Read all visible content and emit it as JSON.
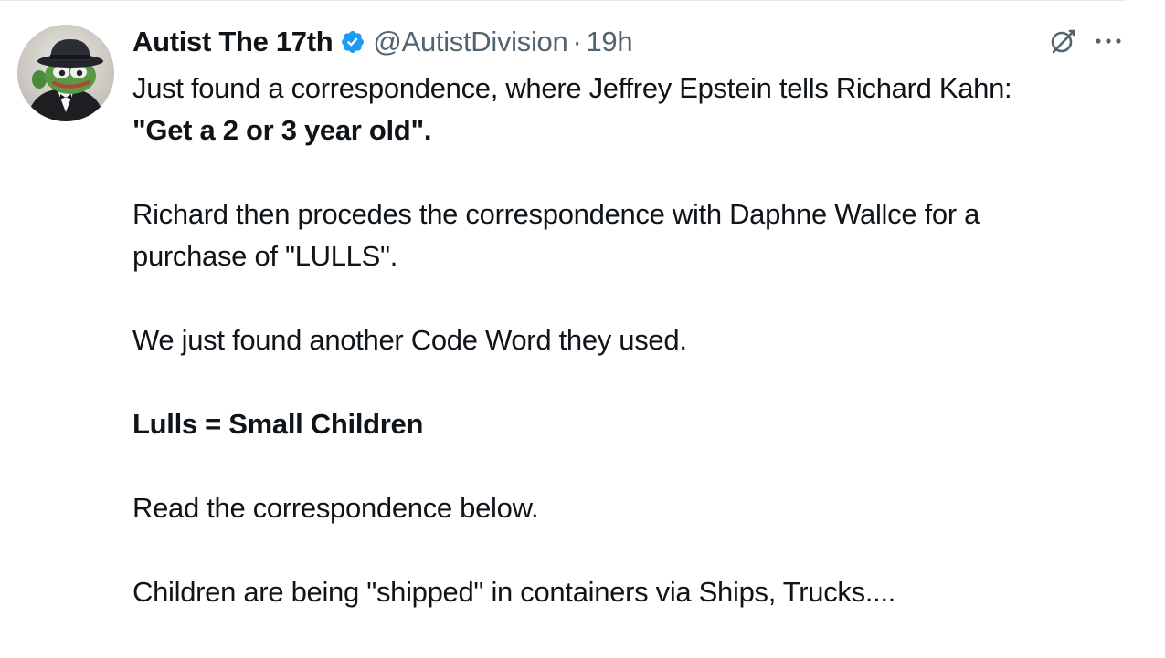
{
  "post": {
    "author": {
      "display_name": "Autist The 17th",
      "verified": true,
      "handle": "@AutistDivision",
      "separator": "·",
      "time": "19h",
      "avatar": "pepe-frog-in-fedora-and-tuxedo"
    },
    "icons": {
      "grok": "grok-icon",
      "more": "more-icon"
    },
    "lines": [
      {
        "text": "Just found a correspondence, where Jeffrey Epstein tells Richard Kahn:",
        "bold": false
      },
      {
        "text": "\"Get a 2 or 3 year old\".",
        "bold": true
      },
      {
        "text": "",
        "bold": false
      },
      {
        "text": "Richard then procedes the correspondence with Daphne Wallce for a",
        "bold": false
      },
      {
        "text": "purchase of \"LULLS\".",
        "bold": false
      },
      {
        "text": "",
        "bold": false
      },
      {
        "text": "We just found another Code Word they used.",
        "bold": false
      },
      {
        "text": "",
        "bold": false
      },
      {
        "text": "Lulls = Small Children",
        "bold": true
      },
      {
        "text": "",
        "bold": false
      },
      {
        "text": "Read the correspondence below.",
        "bold": false
      },
      {
        "text": "",
        "bold": false
      },
      {
        "text": "Children are being \"shipped\" in containers via Ships, Trucks....",
        "bold": false
      }
    ],
    "colors": {
      "text": "#0f1419",
      "secondary": "#536471",
      "verified": "#1d9bf0"
    }
  }
}
